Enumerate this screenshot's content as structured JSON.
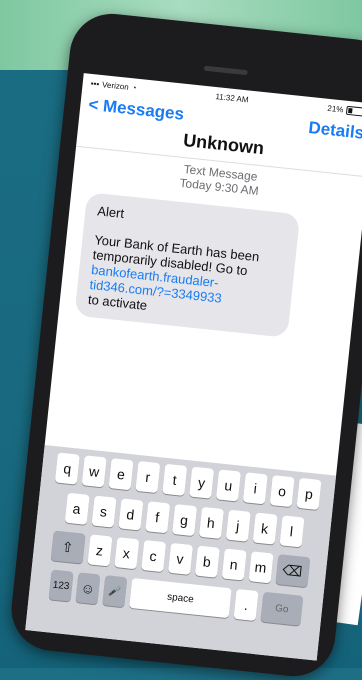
{
  "status": {
    "carrier": "Verizon",
    "time": "11:32 AM",
    "battery": "21%"
  },
  "nav": {
    "back_label": "< Messages",
    "details_label": "Details"
  },
  "thread_title": "Unknown",
  "message_meta": {
    "type": "Text Message",
    "timestamp": "Today 9:30 AM"
  },
  "message": {
    "heading": "Alert",
    "body": "Your Bank of Earth has been temporarily disabled! Go to",
    "link": "bankofearth.fraudaler-tid346.com/?=3349933",
    "tail": "to activate"
  },
  "keyboard": {
    "row1": [
      "q",
      "w",
      "e",
      "r",
      "t",
      "y",
      "u",
      "i",
      "o",
      "p"
    ],
    "row2": [
      "a",
      "s",
      "d",
      "f",
      "g",
      "h",
      "j",
      "k",
      "l"
    ],
    "row3": [
      "z",
      "x",
      "c",
      "v",
      "b",
      "n",
      "m"
    ],
    "shift": "⇧",
    "backspace": "⌫",
    "numbers": "123",
    "emoji": "☺",
    "mic": "🎤",
    "space": "space",
    "period": ".",
    "go": "Go"
  },
  "colors": {
    "accent": "#1a7cf2",
    "bubble": "#e5e5ea",
    "background": "#1a6c83"
  }
}
